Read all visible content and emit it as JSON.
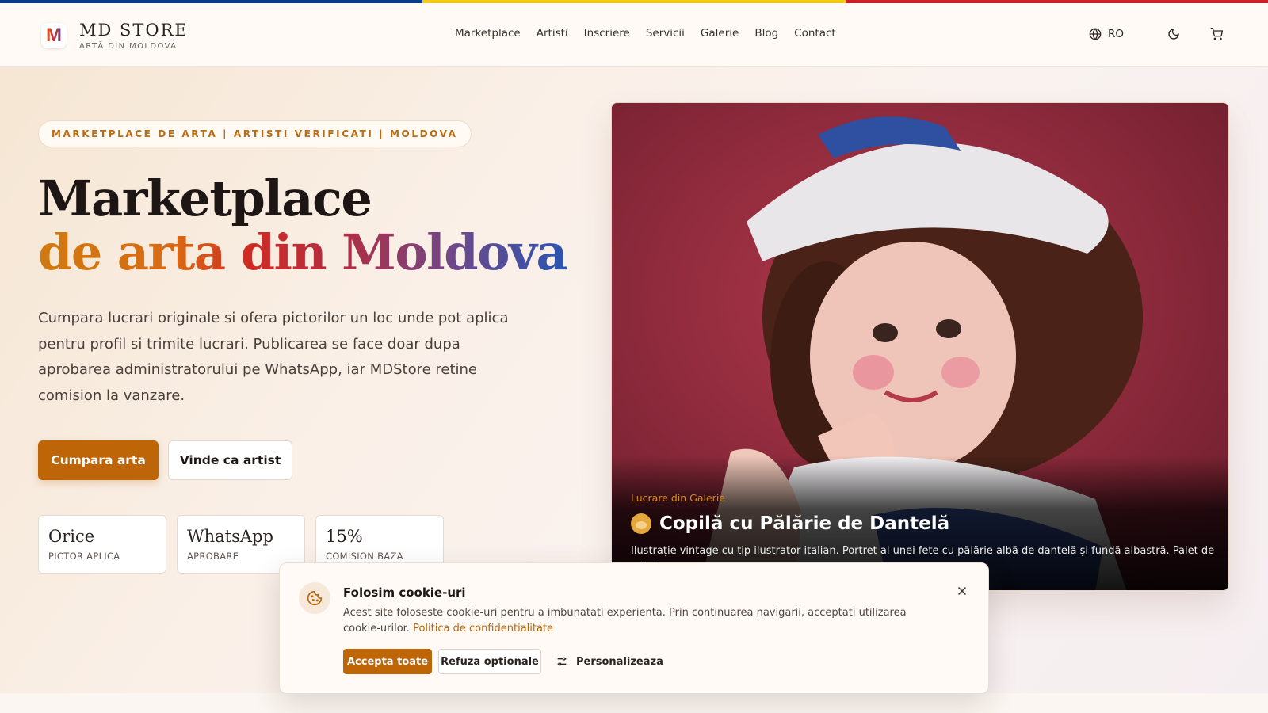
{
  "header": {
    "brand_title": "MD STORE",
    "brand_subtitle": "ARTĂ DIN MOLDOVA",
    "logo_letter": "M",
    "nav": [
      "Marketplace",
      "Artisti",
      "Inscriere",
      "Servicii",
      "Galerie",
      "Blog",
      "Contact"
    ],
    "language": "RO",
    "icons": [
      "globe-icon",
      "moon-icon",
      "cart-icon"
    ]
  },
  "flag_colors": [
    "#0a3a8c",
    "#f2cc12",
    "#cf1d2b"
  ],
  "hero": {
    "badge": "MARKETPLACE DE ARTA | ARTISTI VERIFICATI | MOLDOVA",
    "title_line1": "Marketplace",
    "title_line2": "de arta din Moldova",
    "lead": "Cumpara lucrari originale si ofera pictorilor un loc unde pot aplica pentru profil si trimite lucrari. Publicarea se face doar dupa aprobarea administratorului pe WhatsApp, iar MDStore retine comision la vanzare.",
    "primary_button": "Cumpara arta",
    "secondary_button": "Vinde ca artist",
    "stats": [
      {
        "value": "Orice",
        "label": "PICTOR APLICA"
      },
      {
        "value": "WhatsApp",
        "label": "APROBARE"
      },
      {
        "value": "15%",
        "label": "COMISION BAZA"
      }
    ]
  },
  "featured_art": {
    "kicker": "Lucrare din Galerie",
    "title": "Copilă cu Pălărie de Dantelă",
    "description": "Ilustrație vintage cu tip ilustrator italian. Portret al unei fete cu pălărie albă de dantelă și fundă albastră. Palet de culori"
  },
  "cookie_banner": {
    "title": "Folosim cookie-uri",
    "text": "Acest site foloseste cookie-uri pentru a imbunatati experienta. Prin continuarea navigarii, acceptati utilizarea cookie-urilor.",
    "policy_link": "Politica de confidentialitate",
    "accept": "Accepta toate",
    "refuse": "Refuza optionale",
    "customize": "Personalizeaza"
  },
  "colors": {
    "accent": "#bd6507",
    "background": "#fbf6f1"
  }
}
